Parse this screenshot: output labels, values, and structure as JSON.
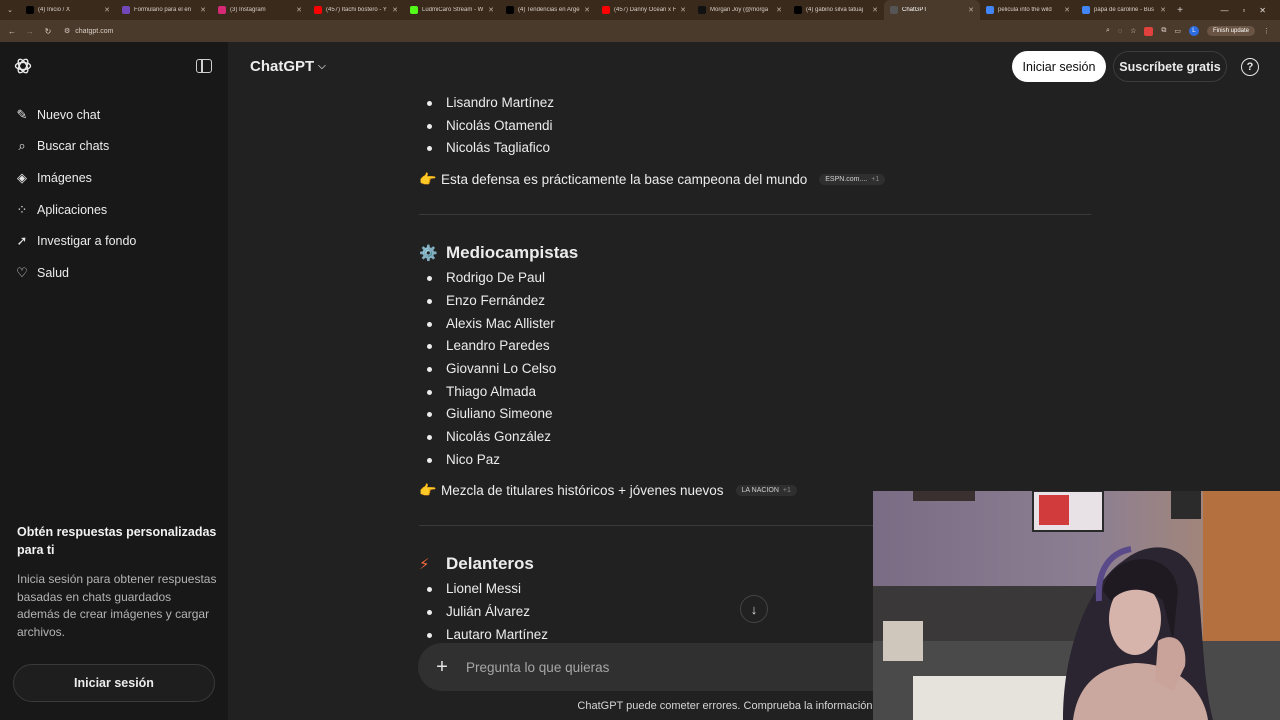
{
  "browser": {
    "tabs": [
      {
        "title": "(4) Inicio / X",
        "icon": "x-logo",
        "color": "#000000"
      },
      {
        "title": "Formulario para el en",
        "icon": "forms",
        "color": "#7248b9"
      },
      {
        "title": "(3) Instagram",
        "icon": "instagram",
        "color": "#d62976"
      },
      {
        "title": "(457) Itachi bostero - Y",
        "icon": "youtube",
        "color": "#ff0000"
      },
      {
        "title": "LudmiCaro Stream - W",
        "icon": "kick",
        "color": "#53fc18"
      },
      {
        "title": "(4) Tendencias en Arge",
        "icon": "x-logo",
        "color": "#000000"
      },
      {
        "title": "(457) Danny Ocean x F",
        "icon": "youtube",
        "color": "#ff0000"
      },
      {
        "title": "Morgan Joy (@morga",
        "icon": "tiktok",
        "color": "#111111"
      },
      {
        "title": "(4) gabino silva tatuaj",
        "icon": "x-logo",
        "color": "#000000"
      },
      {
        "title": "ChatGPT",
        "icon": "chatgpt",
        "color": "#555555",
        "active": true
      },
      {
        "title": "pelicula into the wild",
        "icon": "google",
        "color": "#4285f4"
      },
      {
        "title": "papa de caroline - Bus",
        "icon": "google",
        "color": "#4285f4"
      }
    ],
    "url": "chatgpt.com",
    "finish_update": "Finish update",
    "profile_initial": "L"
  },
  "sidebar": {
    "items": [
      {
        "label": "Nuevo chat",
        "icon": "edit-icon"
      },
      {
        "label": "Buscar chats",
        "icon": "search-icon"
      },
      {
        "label": "Imágenes",
        "icon": "images-icon"
      },
      {
        "label": "Aplicaciones",
        "icon": "apps-icon"
      },
      {
        "label": "Investigar a fondo",
        "icon": "telescope-icon"
      },
      {
        "label": "Salud",
        "icon": "heart-icon"
      }
    ],
    "promo_title": "Obtén respuestas personalizadas para ti",
    "promo_body": "Inicia sesión para obtener respuestas basadas en chats guardados además de crear imágenes y cargar archivos.",
    "login": "Iniciar sesión"
  },
  "header": {
    "model": "ChatGPT",
    "login": "Iniciar sesión",
    "signup": "Suscríbete gratis",
    "help": "?"
  },
  "content": {
    "defense_list": [
      "Lisandro Martínez",
      "Nicolás Otamendi",
      "Nicolás Tagliafico"
    ],
    "defense_note": "Esta defensa es prácticamente la base campeona del mundo",
    "defense_source": "ESPN.com....",
    "defense_source_more": "+1",
    "mid_title": "Mediocampistas",
    "mid_list": [
      "Rodrigo De Paul",
      "Enzo Fernández",
      "Alexis Mac Allister",
      "Leandro Paredes",
      "Giovanni Lo Celso",
      "Thiago Almada",
      "Giuliano Simeone",
      "Nicolás González",
      "Nico Paz"
    ],
    "mid_note": "Mezcla de titulares históricos + jóvenes nuevos",
    "mid_source": "LA NACION",
    "mid_source_more": "+1",
    "fwd_title": "Delanteros",
    "fwd_list": [
      "Lionel Messi",
      "Julián Álvarez",
      "Lautaro Martínez"
    ]
  },
  "composer": {
    "placeholder": "Pregunta lo que quieras"
  },
  "disclaimer": "ChatGPT puede cometer errores. Comprueba la información importante."
}
